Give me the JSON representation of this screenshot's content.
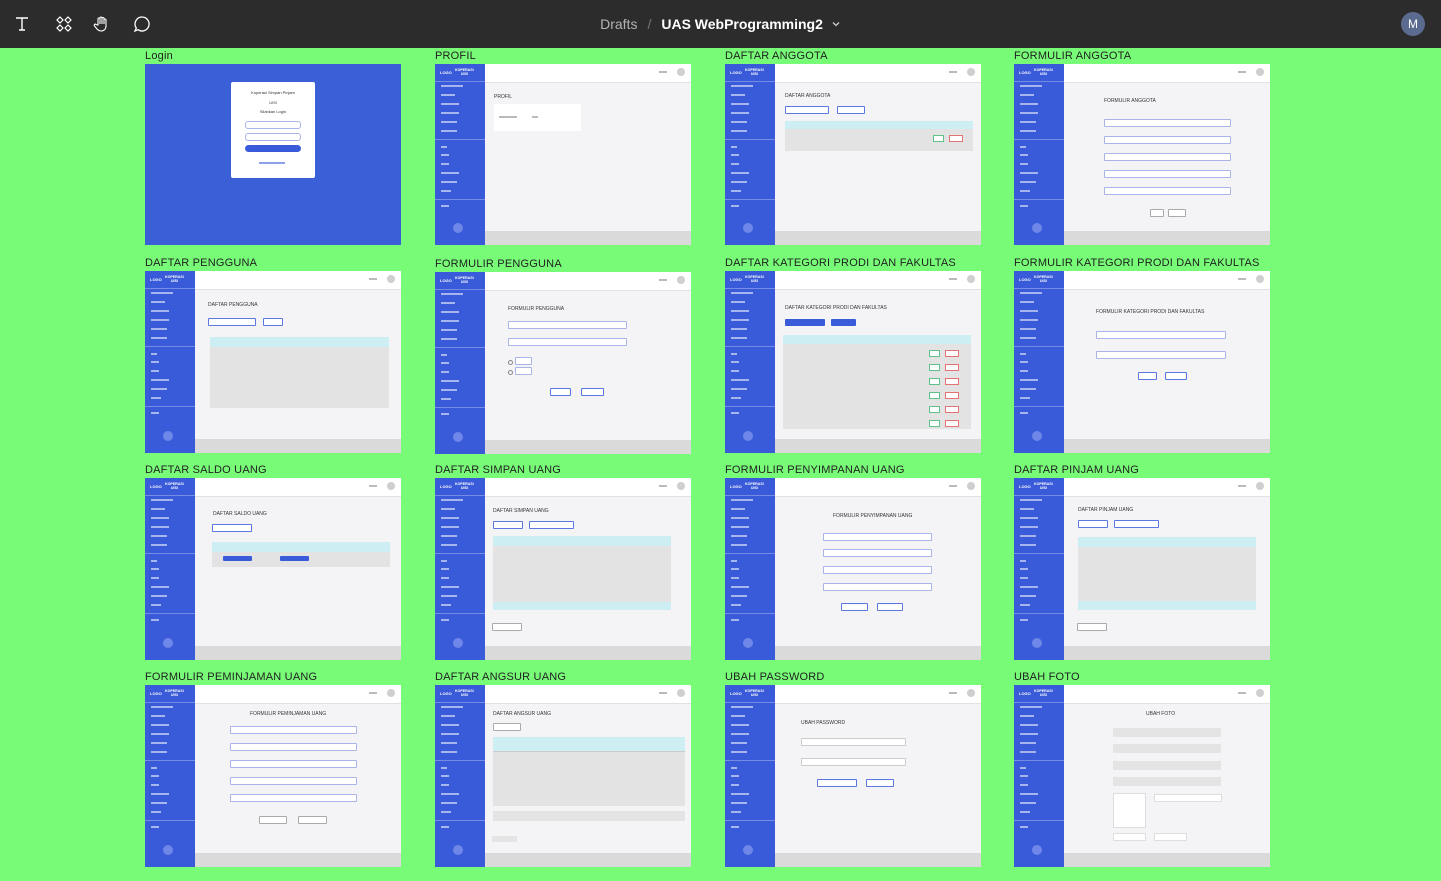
{
  "app": {
    "breadcrumb_root": "Drafts",
    "breadcrumb_sep": "/",
    "file_name": "UAS WebProgramming2",
    "user_initial": "M"
  },
  "toolbar": {
    "tools": [
      "text-icon",
      "components-icon",
      "hand-icon",
      "comment-icon"
    ]
  },
  "frames": [
    {
      "label": "Login"
    },
    {
      "label": "PROFIL"
    },
    {
      "label": "DAFTAR ANGGOTA"
    },
    {
      "label": "FORMULIR ANGGOTA"
    },
    {
      "label": "DAFTAR PENGGUNA"
    },
    {
      "label": "FORMULIR PENGGUNA"
    },
    {
      "label": "DAFTAR KATEGORI PRODI DAN FAKULTAS"
    },
    {
      "label": "FORMULIR KATEGORI PRODI DAN FAKULTAS"
    },
    {
      "label": "DAFTAR SALDO UANG"
    },
    {
      "label": "DAFTAR SIMPAN UANG"
    },
    {
      "label": "FORMULIR PENYIMPANAN UANG"
    },
    {
      "label": "DAFTAR PINJAM UANG"
    },
    {
      "label": "FORMULIR PEMINJAMAN UANG"
    },
    {
      "label": "DAFTAR ANGSUR UANG"
    },
    {
      "label": "UBAH PASSWORD"
    },
    {
      "label": "UBAH FOTO"
    }
  ],
  "mock": {
    "logo": "LOGO",
    "brand_line1": "KOPERASI",
    "brand_line2": "UISI",
    "login_line1": "Koperasi Simpan Pinjam",
    "login_line2": "UISI",
    "login_line3": "Silahkan Login",
    "page_titles": {
      "profil": "PROFIL",
      "daftar_anggota": "DAFTAR ANGGOTA",
      "formulir_anggota": "FORMULIR ANGGOTA",
      "daftar_pengguna": "DAFTAR PENGGUNA",
      "formulir_pengguna": "FORMULIR PENGGUNA",
      "daftar_kategori": "DAFTAR KATEGORI PRODI DAN FAKULTAS",
      "formulir_kategori": "FORMULIR KATEGORI PRODI DAN FAKULTAS",
      "daftar_saldo": "DAFTAR SALDO UANG",
      "daftar_simpan": "DAFTAR SIMPAN UANG",
      "formulir_penyimpanan": "FORMULIR PENYIMPANAN UANG",
      "daftar_pinjam": "DAFTAR PINJAM UANG",
      "formulir_peminjaman": "FORMULIR PEMINJAMAN UANG",
      "daftar_angsur": "DAFTAR ANGSUR UANG",
      "ubah_password": "UBAH PASSWORD",
      "ubah_foto": "UBAH FOTO"
    }
  }
}
